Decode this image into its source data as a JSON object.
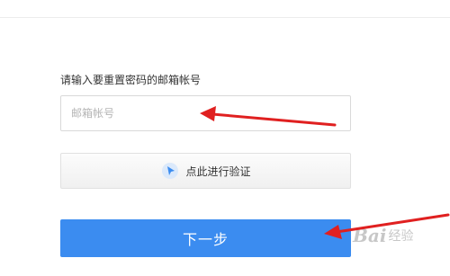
{
  "form": {
    "field_label": "请输入要重置密码的邮箱帐号",
    "email_placeholder": "邮箱帐号",
    "email_value": "",
    "verify_label": "点此进行验证",
    "next_label": "下一步"
  },
  "watermark": {
    "text": "Bai",
    "subtext": "经验"
  },
  "icons": {
    "verify": "cursor-click-icon"
  },
  "colors": {
    "primary": "#3b8cf0",
    "annotation_arrow": "#e02020"
  }
}
